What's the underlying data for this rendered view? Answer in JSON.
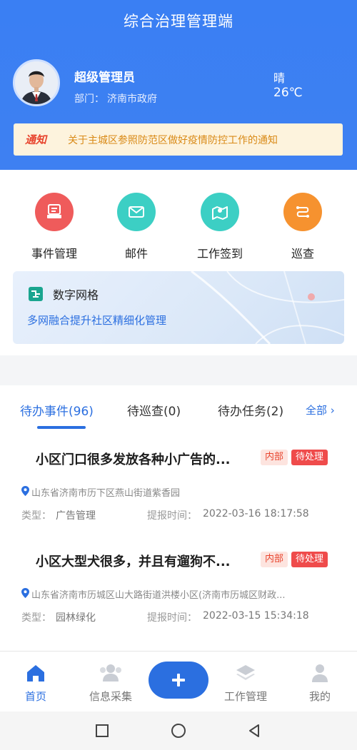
{
  "app": {
    "title": "综合治理管理端"
  },
  "user": {
    "name": "超级管理员",
    "dept_label": "部门：",
    "dept": "济南市政府"
  },
  "weather": {
    "condition": "晴",
    "temperature": "26℃"
  },
  "notice": {
    "tag": "通知",
    "text": "关于主城区参照防范区做好疫情防控工作的通知"
  },
  "quick_actions": [
    {
      "label": "事件管理",
      "icon": "document-icon",
      "color": "#ef5b5b"
    },
    {
      "label": "邮件",
      "icon": "mail-icon",
      "color": "#3ccfc4"
    },
    {
      "label": "工作签到",
      "icon": "map-pin-icon",
      "color": "#3ccfc4"
    },
    {
      "label": "巡查",
      "icon": "route-icon",
      "color": "#f6922f"
    }
  ],
  "banner": {
    "title": "数字网格",
    "subtitle": "多网融合提升社区精细化管理"
  },
  "tabs": {
    "items": [
      {
        "label": "待办事件(96)",
        "active": true
      },
      {
        "label": "待巡查(0)",
        "active": false
      },
      {
        "label": "待办任务(2)",
        "active": false
      }
    ],
    "all_label": "全部"
  },
  "events": [
    {
      "title": "小区门口很多发放各种小广告的...",
      "badge_internal": "内部",
      "badge_status": "待处理",
      "address": "山东省济南市历下区燕山街道紫香园",
      "type_label": "类型：",
      "type": "广告管理",
      "time_label": "提报时间：",
      "time": "2022-03-16 18:17:58"
    },
    {
      "title": "小区大型犬很多，并且有遛狗不...",
      "badge_internal": "内部",
      "badge_status": "待处理",
      "address": "山东省济南市历城区山大路街道洪楼小区(济南市历城区财政...",
      "type_label": "类型：",
      "type": "园林绿化",
      "time_label": "提报时间：",
      "time": "2022-03-15 15:34:18"
    }
  ],
  "tabbar": {
    "items": [
      {
        "label": "首页",
        "icon": "home-icon",
        "active": true
      },
      {
        "label": "信息采集",
        "icon": "users-icon",
        "active": false
      },
      {
        "label": "工作管理",
        "icon": "layers-icon",
        "active": false
      },
      {
        "label": "我的",
        "icon": "person-icon",
        "active": false
      }
    ],
    "fab_icon": "plus-icon"
  },
  "colors": {
    "primary": "#2b6fe0",
    "header": "#3a7ff3",
    "danger": "#ef4b4b",
    "notice_bg": "#fdf3dd"
  }
}
